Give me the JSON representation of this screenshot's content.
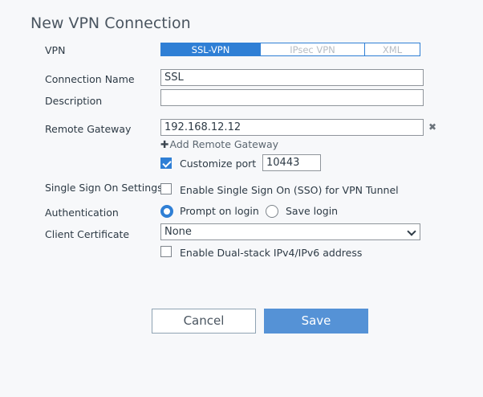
{
  "dialog": {
    "title": "New VPN Connection"
  },
  "vpn": {
    "label": "VPN",
    "options": [
      "SSL-VPN",
      "IPsec VPN",
      "XML"
    ],
    "selected": "SSL-VPN"
  },
  "connection_name": {
    "label": "Connection Name",
    "value": "SSL"
  },
  "description": {
    "label": "Description",
    "value": ""
  },
  "remote_gateway": {
    "label": "Remote Gateway",
    "value": "192.168.12.12",
    "add_label": "Add Remote Gateway"
  },
  "customize_port": {
    "label": "Customize port",
    "checked": true,
    "value": "10443"
  },
  "sso": {
    "label": "Single Sign On Settings",
    "option_label": "Enable Single Sign On (SSO) for VPN Tunnel",
    "checked": false
  },
  "authentication": {
    "label": "Authentication",
    "options": [
      "Prompt on login",
      "Save login"
    ],
    "selected": "Prompt on login"
  },
  "client_certificate": {
    "label": "Client Certificate",
    "value": "None"
  },
  "dual_stack": {
    "label": "Enable Dual-stack IPv4/IPv6 address",
    "checked": false
  },
  "buttons": {
    "cancel": "Cancel",
    "save": "Save"
  },
  "colors": {
    "accent": "#2f7fd5",
    "save_button": "#5592d6"
  },
  "icons": [
    "remove-icon",
    "plus-icon",
    "chevron-down-icon"
  ]
}
